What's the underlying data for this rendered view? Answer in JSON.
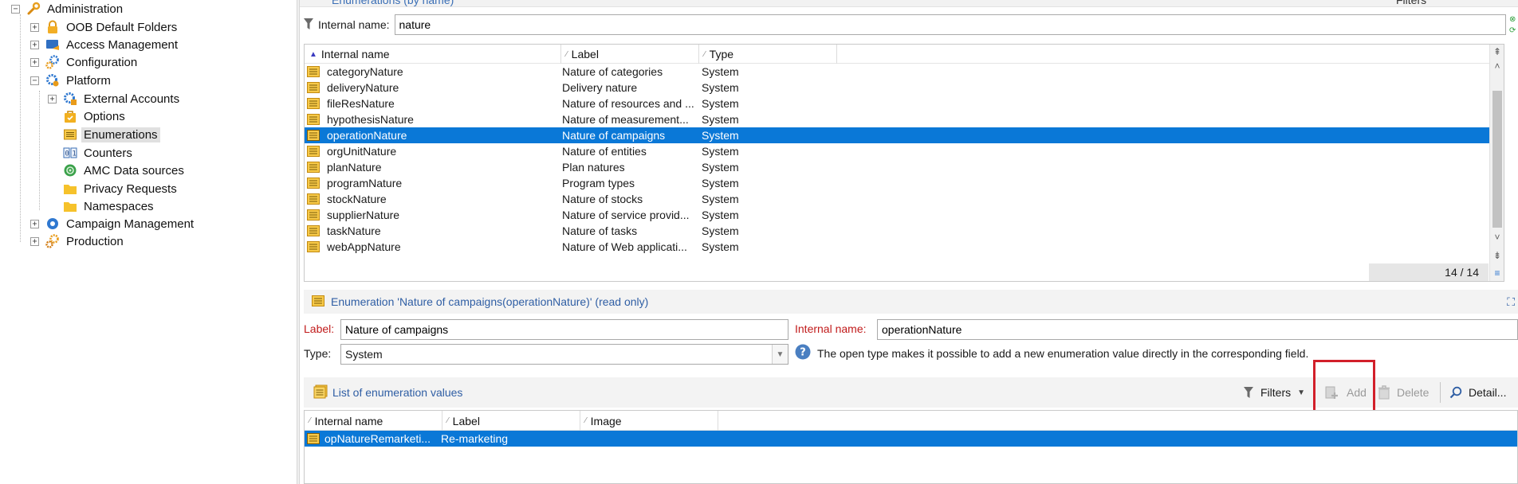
{
  "tree": {
    "root": {
      "label": "Administration",
      "toggle": "−"
    },
    "items": [
      {
        "label": "OOB Default Folders",
        "toggle": "+"
      },
      {
        "label": "Access Management",
        "toggle": "+"
      },
      {
        "label": "Configuration",
        "toggle": "+"
      },
      {
        "label": "Platform",
        "toggle": "−"
      }
    ],
    "platform_children": [
      {
        "label": "External Accounts",
        "toggle": "+"
      },
      {
        "label": "Options"
      },
      {
        "label": "Enumerations"
      },
      {
        "label": "Counters"
      },
      {
        "label": "AMC Data sources"
      },
      {
        "label": "Privacy Requests"
      },
      {
        "label": "Namespaces"
      }
    ],
    "bottom_items": [
      {
        "label": "Campaign Management",
        "toggle": "+"
      },
      {
        "label": "Production",
        "toggle": "+"
      }
    ]
  },
  "top_strip": {
    "title": "Enumerations (by name)",
    "filters_label": "Filters"
  },
  "filter": {
    "label": "Internal name:",
    "value": "nature"
  },
  "enum_grid": {
    "columns": [
      "Internal name",
      "Label",
      "Type"
    ],
    "rows": [
      {
        "name": "categoryNature",
        "label": "Nature of categories",
        "type": "System"
      },
      {
        "name": "deliveryNature",
        "label": "Delivery nature",
        "type": "System"
      },
      {
        "name": "fileResNature",
        "label": "Nature of resources and ...",
        "type": "System"
      },
      {
        "name": "hypothesisNature",
        "label": "Nature of measurement...",
        "type": "System"
      },
      {
        "name": "operationNature",
        "label": "Nature of campaigns",
        "type": "System",
        "selected": true
      },
      {
        "name": "orgUnitNature",
        "label": "Nature of entities",
        "type": "System"
      },
      {
        "name": "planNature",
        "label": "Plan natures",
        "type": "System"
      },
      {
        "name": "programNature",
        "label": "Program types",
        "type": "System"
      },
      {
        "name": "stockNature",
        "label": "Nature of stocks",
        "type": "System"
      },
      {
        "name": "supplierNature",
        "label": "Nature of service provid...",
        "type": "System"
      },
      {
        "name": "taskNature",
        "label": "Nature of tasks",
        "type": "System"
      },
      {
        "name": "webAppNature",
        "label": "Nature of Web applicati...",
        "type": "System"
      }
    ],
    "count": "14 / 14"
  },
  "detail": {
    "title": "Enumeration 'Nature of campaigns(operationNature)' (read only)",
    "label_caption": "Label:",
    "label_value": "Nature of campaigns",
    "internal_caption": "Internal name:",
    "internal_value": "operationNature",
    "type_caption": "Type:",
    "type_value": "System",
    "info_text": "The open type makes it possible to add a new enumeration value directly in the corresponding field."
  },
  "values_toolbar": {
    "title": "List of enumeration values",
    "filters": "Filters",
    "add": "Add",
    "delete": "Delete",
    "detail": "Detail..."
  },
  "values_grid": {
    "columns": [
      "Internal name",
      "Label",
      "Image"
    ],
    "rows": [
      {
        "name": "opNatureRemarketi...",
        "label": "Re-marketing",
        "selected": true
      }
    ]
  },
  "colors": {
    "selection": "#0a78d7",
    "highlight_box": "#d21f2a",
    "link_title": "#2f5ea4"
  }
}
